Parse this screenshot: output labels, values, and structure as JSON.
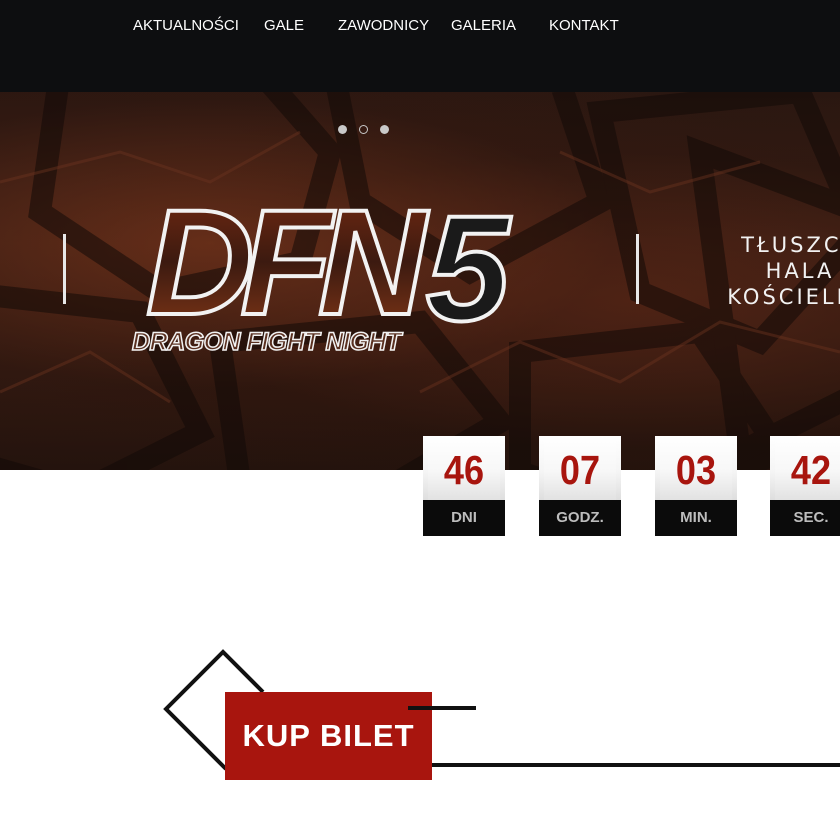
{
  "nav": {
    "items": [
      {
        "label": "AKTUALNOŚCI"
      },
      {
        "label": "GALE"
      },
      {
        "label": "ZAWODNICY"
      },
      {
        "label": "GALERIA"
      },
      {
        "label": "KONTAKT"
      }
    ]
  },
  "hero": {
    "slides": {
      "count": 3,
      "active": 0
    },
    "logo": {
      "main": "DFN",
      "number": "5",
      "subtitle": "DRAGON FIGHT NIGHT"
    },
    "event_lines": [
      "TŁUSZCZ",
      "HALA",
      "KOŚCIELNA"
    ]
  },
  "countdown": [
    {
      "value": "46",
      "label": "DNI"
    },
    {
      "value": "07",
      "label": "GODZ."
    },
    {
      "value": "03",
      "label": "MIN."
    },
    {
      "value": "42",
      "label": "SEC."
    }
  ],
  "ticket": {
    "label": "KUP BILET"
  },
  "colors": {
    "nav_bg": "#0d0e10",
    "accent_red": "#a8150e",
    "countdown_label_bg": "#0b0b0b"
  }
}
